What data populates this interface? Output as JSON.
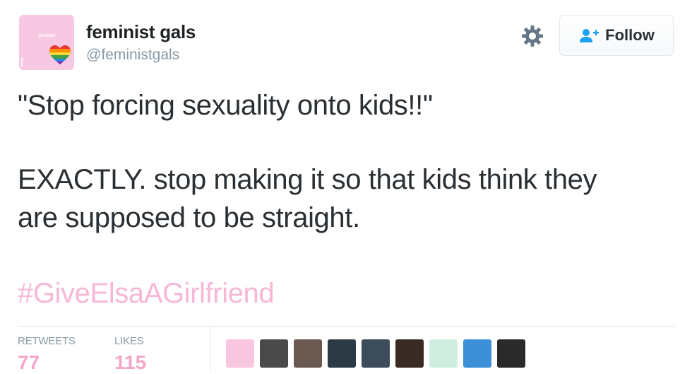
{
  "user": {
    "avatar_text": "feminist",
    "display_name": "feminist gals",
    "handle": "@feministgals"
  },
  "actions": {
    "follow_label": "Follow"
  },
  "tweet": {
    "lines": [
      "\"Stop forcing sexuality onto kids!!\"",
      "EXACTLY. stop making it so that kids think they",
      "are supposed to be straight."
    ],
    "hashtag": "#GiveElsaAGirlfriend"
  },
  "stats": {
    "retweets_label": "RETWEETS",
    "retweets_value": "77",
    "likes_label": "LIKES",
    "likes_value": "115"
  },
  "colors": {
    "hashtag": "#f7b7d6",
    "stat_value": "#f4a6c9",
    "avatar_bg": "#f8c8e2"
  },
  "likers": [
    {
      "name": "liker-avatar-1",
      "color": "#f9c6e0"
    },
    {
      "name": "liker-avatar-2",
      "color": "#4a4a4a"
    },
    {
      "name": "liker-avatar-3",
      "color": "#6b5a52"
    },
    {
      "name": "liker-avatar-4",
      "color": "#2b3a44"
    },
    {
      "name": "liker-avatar-5",
      "color": "#3c4c5a"
    },
    {
      "name": "liker-avatar-6",
      "color": "#3a2a24"
    },
    {
      "name": "liker-avatar-7",
      "color": "#cfeee0"
    },
    {
      "name": "liker-avatar-8",
      "color": "#3d8fd8"
    },
    {
      "name": "liker-avatar-9",
      "color": "#2a2a2a"
    }
  ]
}
